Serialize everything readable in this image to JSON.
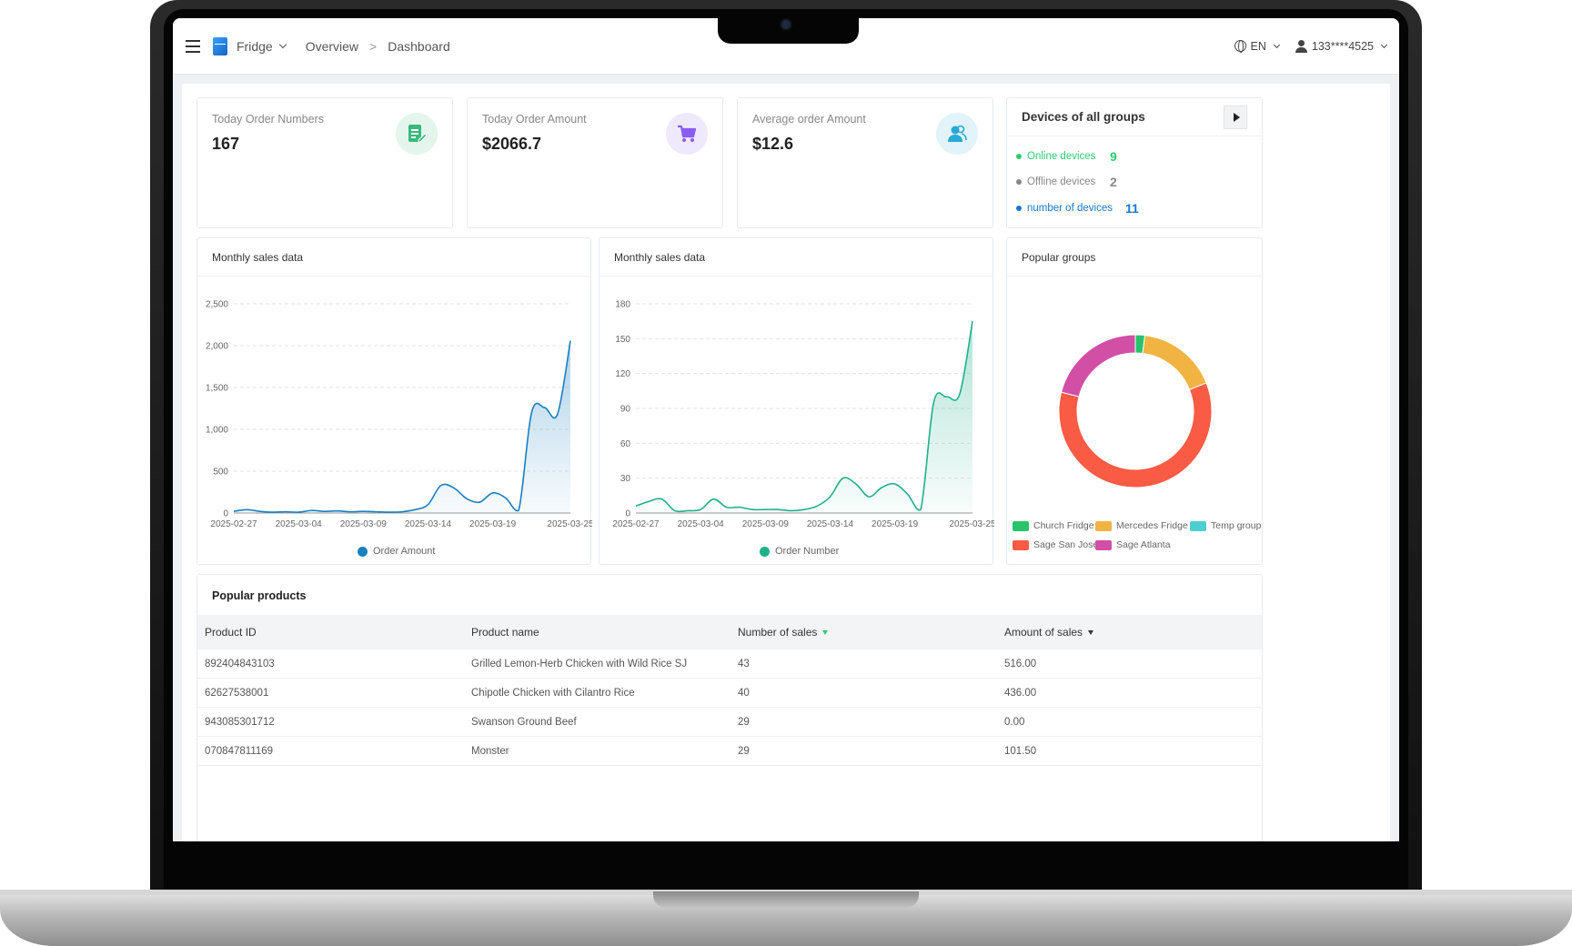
{
  "topbar": {
    "app_name": "Fridge",
    "breadcrumb": [
      "Overview",
      "Dashboard"
    ],
    "breadcrumb_sep": ">",
    "language": "EN",
    "user": "133****4525"
  },
  "stats": [
    {
      "label": "Today Order Numbers",
      "value": "167",
      "icon": "document-edit-icon",
      "color": "#3ab97b",
      "bg": "#e3f5ec"
    },
    {
      "label": "Today Order Amount",
      "value": "$2066.7",
      "icon": "shopping-cart-icon",
      "color": "#8a5cf6",
      "bg": "#efe9fd"
    },
    {
      "label": "Average order Amount",
      "value": "$12.6",
      "icon": "users-icon",
      "color": "#29a9d6",
      "bg": "#e2f3fa"
    }
  ],
  "devices": {
    "title": "Devices of all groups",
    "items": [
      {
        "label": "Online devices",
        "value": "9",
        "color": "#2ecc71"
      },
      {
        "label": "Offline devices",
        "value": "2",
        "color": "#888888"
      },
      {
        "label": "number of devices",
        "value": "11",
        "color": "#1677d2"
      }
    ]
  },
  "chart_data": [
    {
      "type": "area",
      "title": "Monthly sales data",
      "x": [
        "2025-02-27",
        "2025-02-28",
        "2025-03-01",
        "2025-03-02",
        "2025-03-03",
        "2025-03-04",
        "2025-03-05",
        "2025-03-06",
        "2025-03-07",
        "2025-03-08",
        "2025-03-09",
        "2025-03-10",
        "2025-03-11",
        "2025-03-12",
        "2025-03-13",
        "2025-03-14",
        "2025-03-15",
        "2025-03-16",
        "2025-03-17",
        "2025-03-18",
        "2025-03-19",
        "2025-03-20",
        "2025-03-21",
        "2025-03-22",
        "2025-03-23",
        "2025-03-24",
        "2025-03-25"
      ],
      "xticks": [
        "2025-02-27",
        "2025-03-04",
        "2025-03-09",
        "2025-03-14",
        "2025-03-19",
        "2025-03-25"
      ],
      "yticks": [
        "0",
        "500",
        "1,000",
        "1,500",
        "2,000",
        "2,500"
      ],
      "ylim": [
        0,
        2500
      ],
      "series": [
        {
          "name": "Order Amount",
          "color": "#1a7fc1",
          "values": [
            20,
            40,
            20,
            10,
            15,
            10,
            30,
            20,
            25,
            15,
            20,
            15,
            10,
            15,
            40,
            100,
            330,
            300,
            170,
            130,
            240,
            180,
            30,
            1200,
            1260,
            1180,
            2060
          ]
        }
      ]
    },
    {
      "type": "area",
      "title": "Monthly sales data",
      "x": [
        "2025-02-27",
        "2025-02-28",
        "2025-03-01",
        "2025-03-02",
        "2025-03-03",
        "2025-03-04",
        "2025-03-05",
        "2025-03-06",
        "2025-03-07",
        "2025-03-08",
        "2025-03-09",
        "2025-03-10",
        "2025-03-11",
        "2025-03-12",
        "2025-03-13",
        "2025-03-14",
        "2025-03-15",
        "2025-03-16",
        "2025-03-17",
        "2025-03-18",
        "2025-03-19",
        "2025-03-20",
        "2025-03-21",
        "2025-03-22",
        "2025-03-23",
        "2025-03-24",
        "2025-03-25"
      ],
      "xticks": [
        "2025-02-27",
        "2025-03-04",
        "2025-03-09",
        "2025-03-14",
        "2025-03-19",
        "2025-03-25"
      ],
      "yticks": [
        "0",
        "30",
        "60",
        "90",
        "120",
        "150",
        "180"
      ],
      "ylim": [
        0,
        180
      ],
      "series": [
        {
          "name": "Order Number",
          "color": "#1fb08a",
          "values": [
            6,
            10,
            12,
            2,
            2,
            3,
            12,
            5,
            5,
            3,
            3,
            3,
            2,
            3,
            6,
            14,
            30,
            25,
            14,
            22,
            25,
            16,
            3,
            95,
            100,
            102,
            165
          ]
        }
      ]
    },
    {
      "type": "pie",
      "title": "Popular groups",
      "series": [
        {
          "name": "Church Fridge",
          "value": 2,
          "color": "#27c46b"
        },
        {
          "name": "Mercedes Fridge",
          "value": 17,
          "color": "#f1b443"
        },
        {
          "name": "Temp group",
          "value": 0,
          "color": "#4dcfcf"
        },
        {
          "name": "Sage San Jose",
          "value": 60,
          "color": "#f95b45"
        },
        {
          "name": "Sage Atlanta",
          "value": 21,
          "color": "#d24fa6"
        }
      ]
    }
  ],
  "products": {
    "title": "Popular products",
    "columns": [
      "Product ID",
      "Product name",
      "Number of sales",
      "Amount of sales"
    ],
    "rows": [
      [
        "892404843103",
        "Grilled Lemon-Herb Chicken with Wild Rice SJ",
        "43",
        "516.00"
      ],
      [
        "62627538001",
        "Chipotle Chicken with Cilantro Rice",
        "40",
        "436.00"
      ],
      [
        "943085301712",
        "Swanson Ground Beef",
        "29",
        "0.00"
      ],
      [
        "070847811169",
        "Monster",
        "29",
        "101.50"
      ]
    ]
  }
}
